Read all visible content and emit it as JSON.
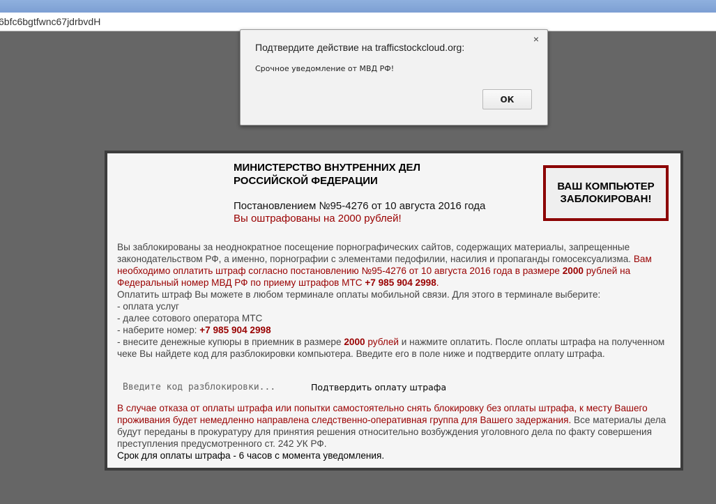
{
  "browser": {
    "address_text": "6bfc6bgtfwnc67jdrbvdH"
  },
  "lock_page": {
    "ministry_line1": "МИНИСТЕРСТВО ВНУТРЕННИХ ДЕЛ",
    "ministry_line2": "РОССИЙСКОЙ ФЕДЕРАЦИИ",
    "decree": "Постановлением №95-4276 от 10 августа 2016 года",
    "fined": "Вы оштрафованы на 2000 рублей!",
    "locked_line1": "ВАШ КОМПЬЮТЕР",
    "locked_line2": "ЗАБЛОКИРОВАН!",
    "para1": "Вы заблокированы за неоднократное посещение порнографических сайтов, содержащих материалы, запрещенные законодательством РФ, а именно, порнографии с элементами педофилии, насилия и пропаганды гомосексуализма.",
    "para1_red_a": " Вам необходимо оплатить штраф согласно постановлению №95-4276 от 10 августа 2016 года в размере ",
    "amount": "2000",
    "para1_red_b": " рублей на Федеральный номер МВД РФ по приему штрафов МТС ",
    "phone": "+7 985 904 2998",
    "para1_end": ".",
    "instructions_intro": "Оплатить штраф Вы можете в любом терминале оплаты мобильной связи. Для этого в терминале выберите:",
    "step1": "- оплата услуг",
    "step2": "- далее сотового оператора МТС",
    "step3": "- наберите номер: ",
    "step4_a": "- внесите денежные купюры в приемник в размере ",
    "step4_b": " рублей",
    "step4_c": " и нажмите оплатить. После оплаты штрафа на полученном чеке Вы найдете код для разблокировки компьютера. Введите его в поле ниже и подтвердите оплату штрафа.",
    "unlock_placeholder": "Введите код разблокировки...",
    "confirm_label": "Подтвердить оплату штрафа",
    "warning_red": "В случае отказа от оплаты штрафа или попытки самостоятельно снять блокировку без оплаты штрафа, к месту Вашего проживания будет немедленно направлена следственно-оперативная группа для Вашего задержания.",
    "warning_grey": " Все материалы дела будут переданы в прокуратуру для принятия решения относительно возбуждения уголовного дела по факту совершения преступления предусмотренного ст. 242 УК РФ.",
    "deadline": "Срок для оплаты штрафа - 6 часов с момента уведомления."
  },
  "dialog": {
    "title": "Подтвердите действие на trafficstockcloud.org:",
    "message": "Срочное уведомление от МВД РФ!",
    "ok_label": "ОК",
    "close_glyph": "×"
  },
  "colors": {
    "background": "#666666",
    "accent_red": "#990000",
    "lock_border": "#8b0000"
  }
}
